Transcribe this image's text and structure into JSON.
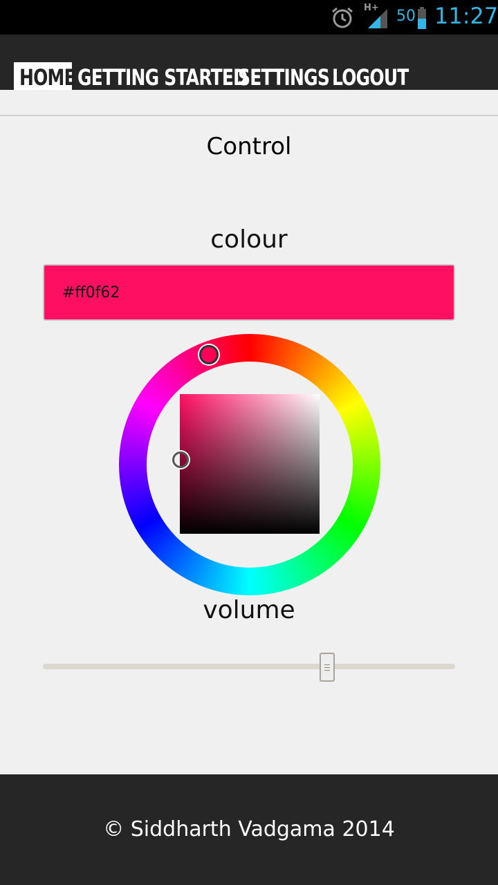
{
  "status_bar": {
    "network_type": "H+",
    "battery_level": "50",
    "time": "11:27",
    "icons": [
      "alarm-icon",
      "signal-icon",
      "battery-icon"
    ]
  },
  "nav": {
    "items": [
      {
        "label": "HOME",
        "active": true
      },
      {
        "label": "GETTING STARTED",
        "active": false
      },
      {
        "label": "SETTINGS",
        "active": false
      },
      {
        "label": "LOGOUT",
        "active": false
      }
    ]
  },
  "page": {
    "title": "Control",
    "colour_label": "colour",
    "colour_value": "#ff0f62",
    "volume_label": "volume",
    "volume_level": 0.69
  },
  "colors": {
    "accent_status": "#33b5e5",
    "selected_colour": "#ff0f62",
    "nav_background": "#262626"
  },
  "footer": {
    "text": "© Siddharth Vadgama 2014"
  }
}
